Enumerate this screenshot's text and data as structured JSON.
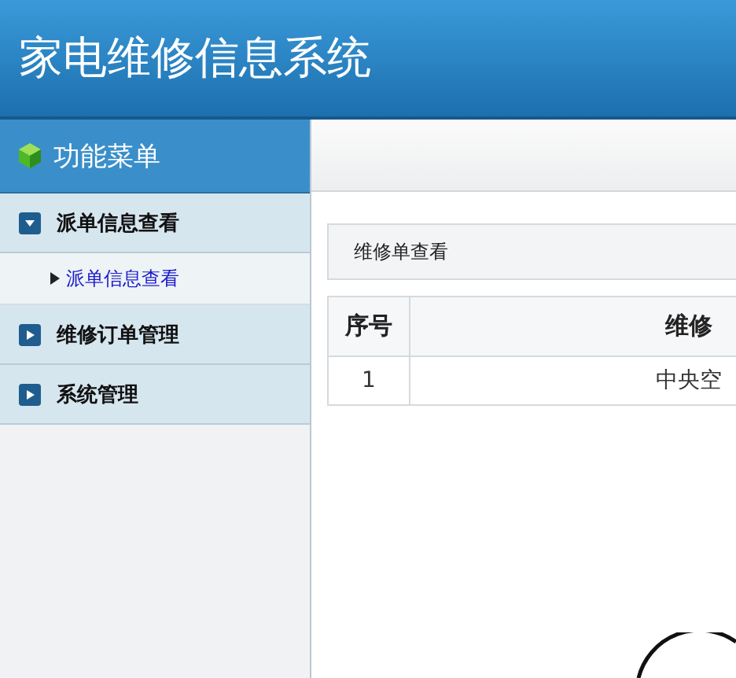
{
  "header": {
    "title": "家电维修信息系统"
  },
  "sidebar": {
    "title": "功能菜单",
    "items": [
      {
        "label": "派单信息查看",
        "expanded": true,
        "children": [
          {
            "label": "派单信息查看",
            "selected": true
          }
        ]
      },
      {
        "label": "维修订单管理",
        "expanded": false
      },
      {
        "label": "系统管理",
        "expanded": false
      }
    ]
  },
  "panel": {
    "title": "维修单查看"
  },
  "table": {
    "columns": [
      "序号",
      "维修"
    ],
    "rows": [
      [
        "1",
        "中央空"
      ]
    ]
  }
}
